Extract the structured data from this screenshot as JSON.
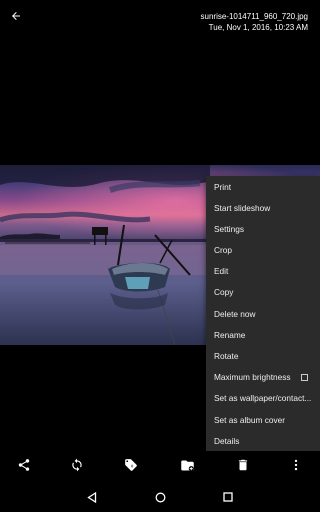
{
  "header": {
    "filename": "sunrise-1014711_960_720.jpg",
    "datetime": "Tue, Nov 1, 2016, 10:23 AM",
    "back_icon": "arrow-back-icon"
  },
  "menu": {
    "items": [
      {
        "label": "Print"
      },
      {
        "label": "Start slideshow"
      },
      {
        "label": "Settings"
      },
      {
        "label": "Crop"
      },
      {
        "label": "Edit"
      },
      {
        "label": "Copy"
      },
      {
        "label": "Delete now"
      },
      {
        "label": "Rename"
      },
      {
        "label": "Rotate"
      },
      {
        "label": "Maximum brightness",
        "checkbox": false
      },
      {
        "label": "Set as wallpaper/contact..."
      },
      {
        "label": "Set as album cover"
      },
      {
        "label": "Details"
      }
    ],
    "background": "#2b2b2b"
  },
  "toolbar": {
    "icons": [
      "share-icon",
      "rotate-icon",
      "tag-icon",
      "move-to-folder-icon",
      "delete-icon",
      "more-vert-icon"
    ]
  },
  "navbar": {
    "icons": [
      "nav-back-icon",
      "nav-home-icon",
      "nav-recents-icon"
    ]
  }
}
